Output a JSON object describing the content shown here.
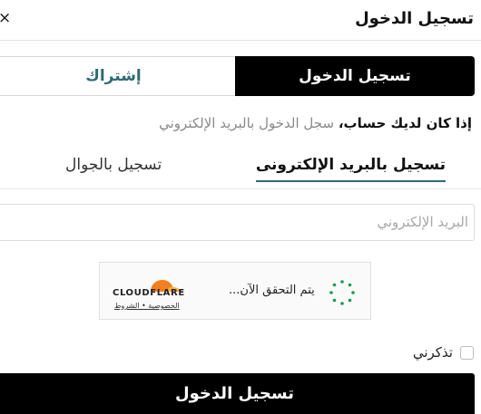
{
  "header": {
    "title": "تسجيل الدخول",
    "close_icon": "×"
  },
  "tabs": {
    "login": "تسجيل الدخول",
    "signup": "إشتراك"
  },
  "hint": {
    "bold": "إذا كان لديك حساب،",
    "rest": " سجل الدخول بالبريد الإلكتروني"
  },
  "sub_tabs": {
    "email": "تسجيل بالبريد الإلكترونى",
    "phone": "تسجيل بالجوال"
  },
  "email_field": {
    "placeholder": "البريد الإلكتروني"
  },
  "captcha": {
    "status": "يتم التحقق الآن...",
    "brand": "CLOUDFLARE",
    "links": "الخصوصية • الشروط",
    "brand_color": "#f38020"
  },
  "remember": {
    "label": "تذكرني"
  },
  "submit": {
    "label": "تسجيل الدخول"
  },
  "colors": {
    "accent": "#2d6c70",
    "primary": "#000000"
  }
}
